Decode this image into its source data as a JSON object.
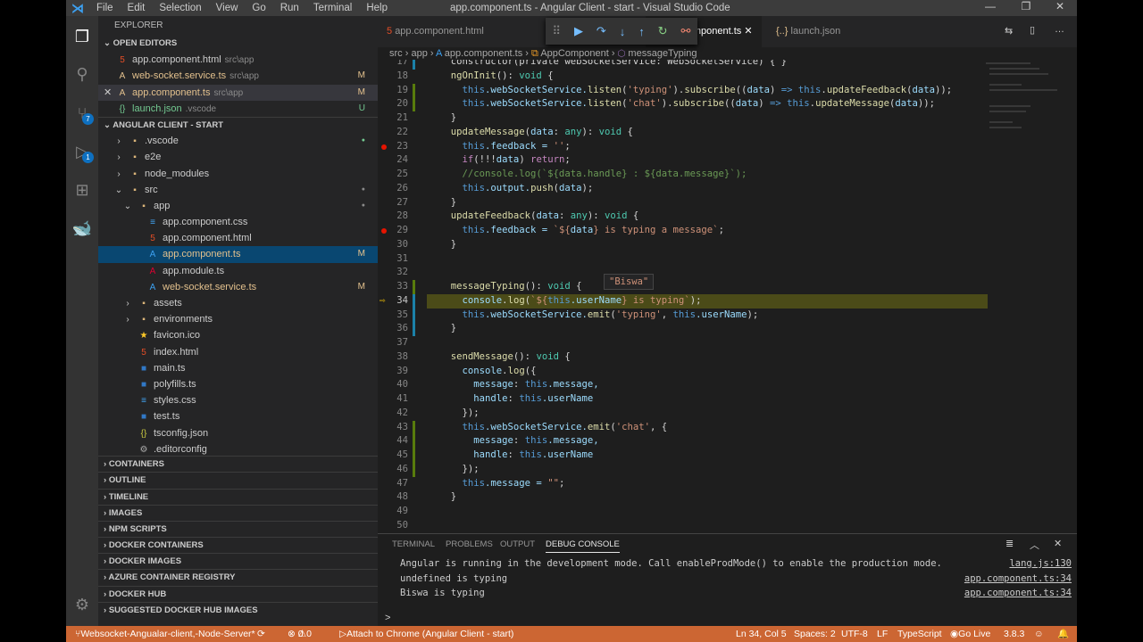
{
  "window": {
    "title": "app.component.ts - Angular Client - start - Visual Studio Code",
    "menu": [
      "File",
      "Edit",
      "Selection",
      "View",
      "Go",
      "Run",
      "Terminal",
      "Help"
    ]
  },
  "activity": {
    "scm_badge": "7",
    "debug_badge": "1"
  },
  "explorer": {
    "header": "EXPLORER",
    "open_editors": "OPEN EDITORS",
    "open": [
      {
        "name": "app.component.html",
        "desc": "src\\app",
        "status": "",
        "icon": "5",
        "color": "#e44d26"
      },
      {
        "name": "web-socket.service.ts",
        "desc": "src\\app",
        "status": "M",
        "icon": "A",
        "color": "#e2c08d"
      },
      {
        "name": "app.component.ts",
        "desc": "src\\app",
        "status": "M",
        "icon": "A",
        "color": "#e2c08d"
      },
      {
        "name": "launch.json",
        "desc": ".vscode",
        "status": "U",
        "icon": "{}",
        "color": "#73c991"
      }
    ],
    "project": "ANGULAR CLIENT - START",
    "tree": [
      {
        "name": ".vscode",
        "d": 1,
        "t": "folder",
        "arrow": ">"
      },
      {
        "name": "e2e",
        "d": 1,
        "t": "folder",
        "arrow": ">"
      },
      {
        "name": "node_modules",
        "d": 1,
        "t": "folder",
        "arrow": ">"
      },
      {
        "name": "src",
        "d": 1,
        "t": "folder",
        "arrow": "v"
      },
      {
        "name": "app",
        "d": 2,
        "t": "folder",
        "arrow": "v"
      },
      {
        "name": "app.component.css",
        "d": 3,
        "t": "css"
      },
      {
        "name": "app.component.html",
        "d": 3,
        "t": "html"
      },
      {
        "name": "app.component.ts",
        "d": 3,
        "t": "ts",
        "status": "M"
      },
      {
        "name": "app.module.ts",
        "d": 3,
        "t": "ng"
      },
      {
        "name": "web-socket.service.ts",
        "d": 3,
        "t": "ts",
        "status": "M"
      },
      {
        "name": "assets",
        "d": 2,
        "t": "folder",
        "arrow": ">"
      },
      {
        "name": "environments",
        "d": 2,
        "t": "folder",
        "arrow": ">"
      },
      {
        "name": "favicon.ico",
        "d": 2,
        "t": "ico"
      },
      {
        "name": "index.html",
        "d": 2,
        "t": "html"
      },
      {
        "name": "main.ts",
        "d": 2,
        "t": "tsf"
      },
      {
        "name": "polyfills.ts",
        "d": 2,
        "t": "tsf"
      },
      {
        "name": "styles.css",
        "d": 2,
        "t": "css"
      },
      {
        "name": "test.ts",
        "d": 2,
        "t": "tsf"
      },
      {
        "name": "tsconfig.json",
        "d": 2,
        "t": "json"
      },
      {
        "name": ".editorconfig",
        "d": 2,
        "t": "cfg"
      }
    ],
    "sections": [
      "CONTAINERS",
      "OUTLINE",
      "TIMELINE",
      "IMAGES",
      "NPM SCRIPTS",
      "DOCKER CONTAINERS",
      "DOCKER IMAGES",
      "AZURE CONTAINER REGISTRY",
      "DOCKER HUB",
      "SUGGESTED DOCKER HUB IMAGES"
    ]
  },
  "tabs": [
    {
      "label": "app.component.html"
    },
    {
      "label": "app.component.ts"
    },
    {
      "label": "launch.json"
    }
  ],
  "breadcrumb": [
    "src",
    "app",
    "app.component.ts",
    "AppComponent",
    "messageTyping"
  ],
  "hover": "\"Biswa\"",
  "code": [
    {
      "n": "17",
      "t": [
        [
          "  constructor(private webSocketService: WebSocketService) { }",
          "p"
        ]
      ]
    },
    {
      "n": "18",
      "t": [
        [
          "  ngOnInit",
          "fn"
        ],
        [
          "(): ",
          "p"
        ],
        [
          "void",
          "ty"
        ],
        [
          " {",
          "p"
        ]
      ]
    },
    {
      "n": "19",
      "t": [
        [
          "    this",
          "kw"
        ],
        [
          ".webSocketService.",
          "var"
        ],
        [
          "listen",
          "fn"
        ],
        [
          "(",
          "p"
        ],
        [
          "'typing'",
          "str"
        ],
        [
          ").",
          "p"
        ],
        [
          "subscribe",
          "fn"
        ],
        [
          "((",
          "p"
        ],
        [
          "data",
          "var"
        ],
        [
          ") ",
          "p"
        ],
        [
          "=>",
          "kw"
        ],
        [
          " this",
          "kw"
        ],
        [
          ".",
          "p"
        ],
        [
          "updateFeedback",
          "fn"
        ],
        [
          "(",
          "p"
        ],
        [
          "data",
          "var"
        ],
        [
          "));",
          "p"
        ]
      ]
    },
    {
      "n": "20",
      "t": [
        [
          "    this",
          "kw"
        ],
        [
          ".webSocketService.",
          "var"
        ],
        [
          "listen",
          "fn"
        ],
        [
          "(",
          "p"
        ],
        [
          "'chat'",
          "str"
        ],
        [
          ").",
          "p"
        ],
        [
          "subscribe",
          "fn"
        ],
        [
          "((",
          "p"
        ],
        [
          "data",
          "var"
        ],
        [
          ") ",
          "p"
        ],
        [
          "=>",
          "kw"
        ],
        [
          " this",
          "kw"
        ],
        [
          ".",
          "p"
        ],
        [
          "updateMessage",
          "fn"
        ],
        [
          "(",
          "p"
        ],
        [
          "data",
          "var"
        ],
        [
          "));",
          "p"
        ]
      ]
    },
    {
      "n": "21",
      "t": [
        [
          "  }",
          "p"
        ]
      ]
    },
    {
      "n": "22",
      "t": [
        [
          "  updateMessage",
          "fn"
        ],
        [
          "(",
          "p"
        ],
        [
          "data",
          "var"
        ],
        [
          ": ",
          "p"
        ],
        [
          "any",
          "ty"
        ],
        [
          "): ",
          "p"
        ],
        [
          "void",
          "ty"
        ],
        [
          " {",
          "p"
        ]
      ]
    },
    {
      "n": "23",
      "bp": true,
      "t": [
        [
          "    this",
          "kw"
        ],
        [
          ".feedback = ",
          "var"
        ],
        [
          "''",
          "str"
        ],
        [
          ";",
          "p"
        ]
      ]
    },
    {
      "n": "24",
      "t": [
        [
          "    if",
          "ctl"
        ],
        [
          "(!!!",
          "p"
        ],
        [
          "data",
          "var"
        ],
        [
          ") ",
          "p"
        ],
        [
          "return",
          "ctl"
        ],
        [
          ";",
          "p"
        ]
      ]
    },
    {
      "n": "25",
      "t": [
        [
          "    //console.log(`${data.handle} : ${data.message}`);",
          "cm"
        ]
      ]
    },
    {
      "n": "26",
      "t": [
        [
          "    this",
          "kw"
        ],
        [
          ".output.",
          "var"
        ],
        [
          "push",
          "fn"
        ],
        [
          "(",
          "p"
        ],
        [
          "data",
          "var"
        ],
        [
          ");",
          "p"
        ]
      ]
    },
    {
      "n": "27",
      "t": [
        [
          "  }",
          "p"
        ]
      ]
    },
    {
      "n": "28",
      "t": [
        [
          "  updateFeedback",
          "fn"
        ],
        [
          "(",
          "p"
        ],
        [
          "data",
          "var"
        ],
        [
          ": ",
          "p"
        ],
        [
          "any",
          "ty"
        ],
        [
          "): ",
          "p"
        ],
        [
          "void",
          "ty"
        ],
        [
          " {",
          "p"
        ]
      ]
    },
    {
      "n": "29",
      "bp": true,
      "t": [
        [
          "    this",
          "kw"
        ],
        [
          ".feedback = ",
          "var"
        ],
        [
          "`${",
          "str"
        ],
        [
          "data",
          "var"
        ],
        [
          "} is typing a message`",
          "str"
        ],
        [
          ";",
          "p"
        ]
      ]
    },
    {
      "n": "30",
      "t": [
        [
          "  }",
          "p"
        ]
      ]
    },
    {
      "n": "31",
      "t": []
    },
    {
      "n": "32",
      "t": []
    },
    {
      "n": "33",
      "t": [
        [
          "  messageTyping",
          "fn"
        ],
        [
          "(): ",
          "p"
        ],
        [
          "void",
          "ty"
        ],
        [
          " {",
          "p"
        ]
      ]
    },
    {
      "n": "34",
      "cur": true,
      "t": [
        [
          "    console",
          "var"
        ],
        [
          ".",
          "p"
        ],
        [
          "log",
          "fn"
        ],
        [
          "(",
          "p"
        ],
        [
          "`${",
          "str"
        ],
        [
          "this",
          "kw"
        ],
        [
          ".userName",
          "var"
        ],
        [
          "} is typing`",
          "str"
        ],
        [
          ");",
          "p"
        ]
      ]
    },
    {
      "n": "35",
      "t": [
        [
          "    this",
          "kw"
        ],
        [
          ".webSocketService.",
          "var"
        ],
        [
          "emit",
          "fn"
        ],
        [
          "(",
          "p"
        ],
        [
          "'typing'",
          "str"
        ],
        [
          ", ",
          "p"
        ],
        [
          "this",
          "kw"
        ],
        [
          ".userName",
          "var"
        ],
        [
          ");",
          "p"
        ]
      ]
    },
    {
      "n": "36",
      "t": [
        [
          "  }",
          "p"
        ]
      ]
    },
    {
      "n": "37",
      "t": []
    },
    {
      "n": "38",
      "t": [
        [
          "  sendMessage",
          "fn"
        ],
        [
          "(): ",
          "p"
        ],
        [
          "void",
          "ty"
        ],
        [
          " {",
          "p"
        ]
      ]
    },
    {
      "n": "39",
      "t": [
        [
          "    console",
          "var"
        ],
        [
          ".",
          "p"
        ],
        [
          "log",
          "fn"
        ],
        [
          "({",
          "p"
        ]
      ]
    },
    {
      "n": "40",
      "t": [
        [
          "      message",
          "var"
        ],
        [
          ": ",
          "p"
        ],
        [
          "this",
          "kw"
        ],
        [
          ".message,",
          "var"
        ]
      ]
    },
    {
      "n": "41",
      "t": [
        [
          "      handle",
          "var"
        ],
        [
          ": ",
          "p"
        ],
        [
          "this",
          "kw"
        ],
        [
          ".userName",
          "var"
        ]
      ]
    },
    {
      "n": "42",
      "t": [
        [
          "    });",
          "p"
        ]
      ]
    },
    {
      "n": "43",
      "t": [
        [
          "    this",
          "kw"
        ],
        [
          ".webSocketService.",
          "var"
        ],
        [
          "emit",
          "fn"
        ],
        [
          "(",
          "p"
        ],
        [
          "'chat'",
          "str"
        ],
        [
          ", {",
          "p"
        ]
      ]
    },
    {
      "n": "44",
      "t": [
        [
          "      message",
          "var"
        ],
        [
          ": ",
          "p"
        ],
        [
          "this",
          "kw"
        ],
        [
          ".message,",
          "var"
        ]
      ]
    },
    {
      "n": "45",
      "t": [
        [
          "      handle",
          "var"
        ],
        [
          ": ",
          "p"
        ],
        [
          "this",
          "kw"
        ],
        [
          ".userName",
          "var"
        ]
      ]
    },
    {
      "n": "46",
      "t": [
        [
          "    });",
          "p"
        ]
      ]
    },
    {
      "n": "47",
      "t": [
        [
          "    this",
          "kw"
        ],
        [
          ".message = ",
          "var"
        ],
        [
          "\"\"",
          "str"
        ],
        [
          ";",
          "p"
        ]
      ]
    },
    {
      "n": "48",
      "t": [
        [
          "  }",
          "p"
        ]
      ]
    },
    {
      "n": "49",
      "t": []
    },
    {
      "n": "50",
      "t": []
    }
  ],
  "panel": {
    "tabs": [
      "TERMINAL",
      "PROBLEMS",
      "OUTPUT",
      "DEBUG CONSOLE"
    ],
    "lines": [
      {
        "text": "Angular is running in the development mode. Call enableProdMode() to enable the production mode.",
        "src": "lang.js:130"
      },
      {
        "text": "undefined is typing",
        "src": "app.component.ts:34"
      },
      {
        "text": "Biswa is typing",
        "src": "app.component.ts:34"
      }
    ],
    "prompt": ">"
  },
  "status": {
    "branch": "Websocket-Angualar-client,-Node-Server*",
    "errors": "0",
    "warnings": "0",
    "debug": "Attach to Chrome (Angular Client - start)",
    "position": "Ln 34, Col 5",
    "spaces": "Spaces: 2",
    "encoding": "UTF-8",
    "eol": "LF",
    "language": "TypeScript",
    "golive": "Go Live",
    "version": "3.8.3"
  }
}
